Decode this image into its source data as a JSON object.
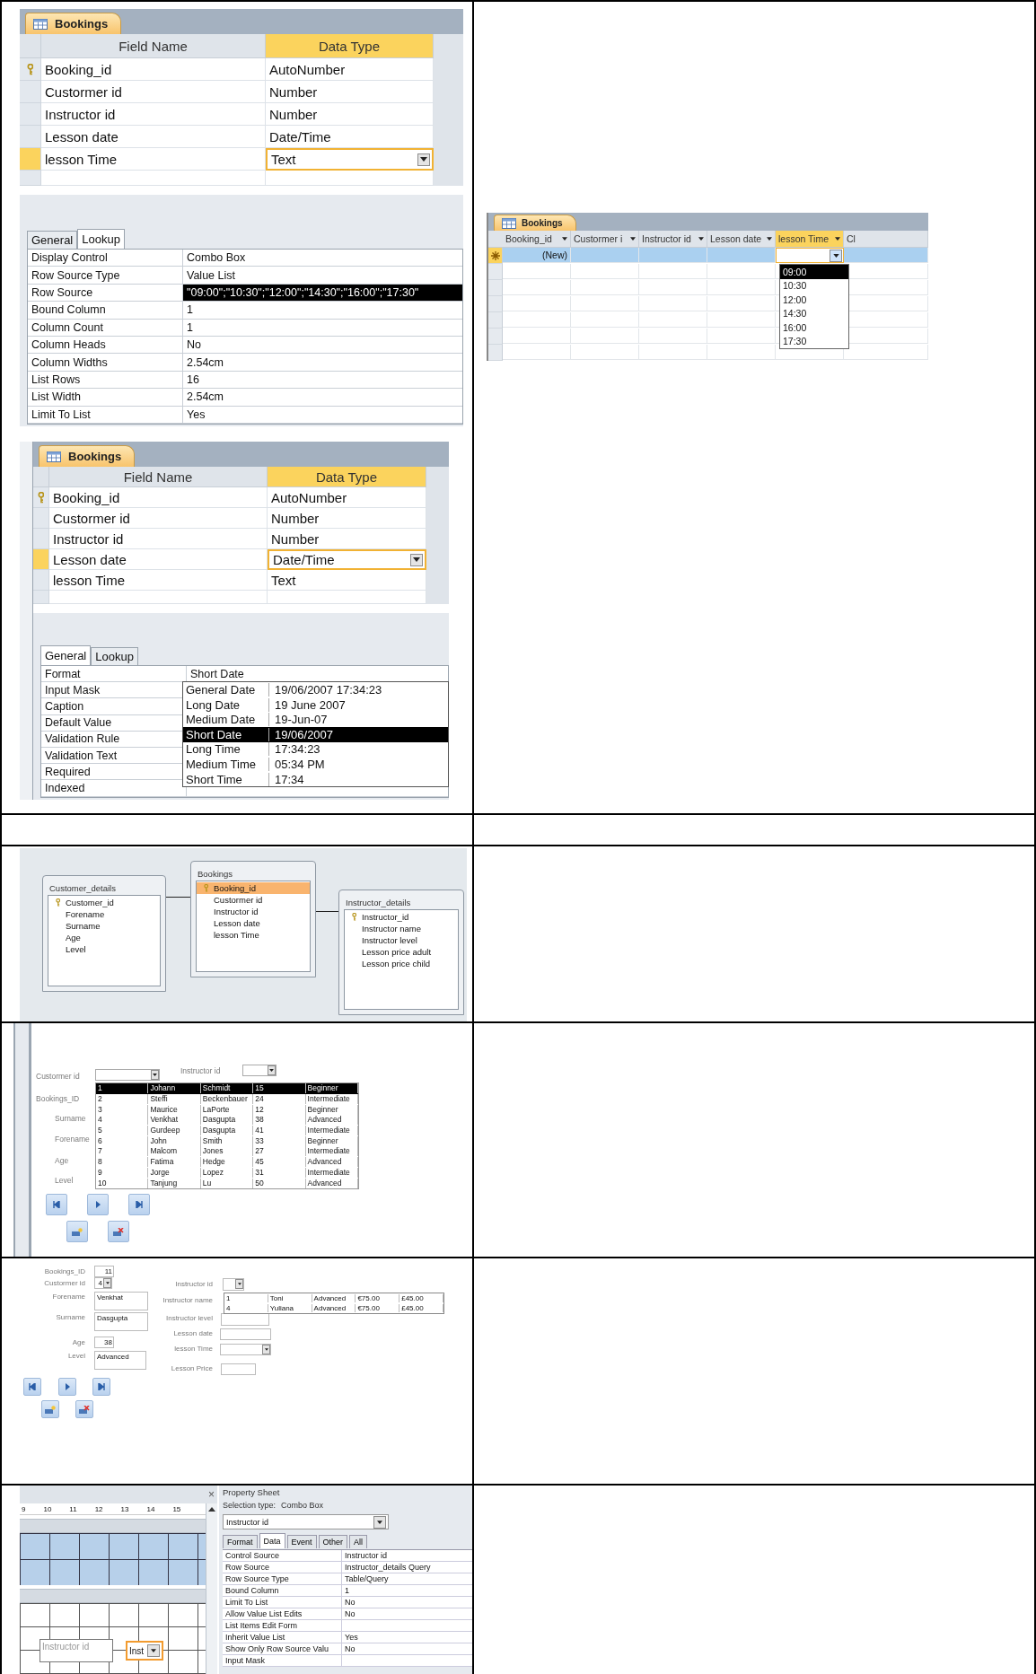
{
  "design_views": [
    {
      "tab": "Bookings",
      "columns": [
        {
          "label": "Field Name",
          "selected": false
        },
        {
          "label": "Data Type",
          "selected": true
        }
      ],
      "fields": [
        {
          "name": "Booking_id",
          "type": "AutoNumber",
          "primary_key": true,
          "selected": false
        },
        {
          "name": "Custormer id",
          "type": "Number",
          "primary_key": false,
          "selected": false
        },
        {
          "name": "Instructor id",
          "type": "Number",
          "primary_key": false,
          "selected": false
        },
        {
          "name": "Lesson date",
          "type": "Date/Time",
          "primary_key": false,
          "selected": false
        },
        {
          "name": "lesson Time",
          "type": "Text",
          "primary_key": false,
          "selected": true
        }
      ],
      "property_tabs": [
        {
          "label": "General",
          "selected": false
        },
        {
          "label": "Lookup",
          "selected": true
        }
      ],
      "properties": [
        {
          "name": "Display Control",
          "value": "Combo Box",
          "selected": false
        },
        {
          "name": "Row Source Type",
          "value": "Value List",
          "selected": false
        },
        {
          "name": "Row Source",
          "value": "\"09:00\";\"10:30\";\"12:00\";\"14:30\";\"16:00\";\"17:30\"",
          "selected": true
        },
        {
          "name": "Bound Column",
          "value": "1",
          "selected": false
        },
        {
          "name": "Column Count",
          "value": "1",
          "selected": false
        },
        {
          "name": "Column Heads",
          "value": "No",
          "selected": false
        },
        {
          "name": "Column Widths",
          "value": "2.54cm",
          "selected": false
        },
        {
          "name": "List Rows",
          "value": "16",
          "selected": false
        },
        {
          "name": "List Width",
          "value": "2.54cm",
          "selected": false
        },
        {
          "name": "Limit To List",
          "value": "Yes",
          "selected": false
        }
      ]
    },
    {
      "tab": "Bookings",
      "columns": [
        {
          "label": "Field Name",
          "selected": false
        },
        {
          "label": "Data Type",
          "selected": true
        }
      ],
      "fields": [
        {
          "name": "Booking_id",
          "type": "AutoNumber",
          "primary_key": true,
          "selected": false
        },
        {
          "name": "Custormer id",
          "type": "Number",
          "primary_key": false,
          "selected": false
        },
        {
          "name": "Instructor id",
          "type": "Number",
          "primary_key": false,
          "selected": false
        },
        {
          "name": "Lesson date",
          "type": "Date/Time",
          "primary_key": false,
          "selected": true
        },
        {
          "name": "lesson Time",
          "type": "Text",
          "primary_key": false,
          "selected": false
        }
      ],
      "property_tabs": [
        {
          "label": "General",
          "selected": true
        },
        {
          "label": "Lookup",
          "selected": false
        }
      ],
      "properties": [
        {
          "name": "Format",
          "value": "Short Date"
        },
        {
          "name": "Input Mask"
        },
        {
          "name": "Caption"
        },
        {
          "name": "Default Value"
        },
        {
          "name": "Validation Rule"
        },
        {
          "name": "Validation Text"
        },
        {
          "name": "Required"
        },
        {
          "name": "Indexed"
        }
      ],
      "format_list": [
        {
          "name": "General Date",
          "example": "19/06/2007 17:34:23",
          "selected": false
        },
        {
          "name": "Long Date",
          "example": "19 June 2007",
          "selected": false
        },
        {
          "name": "Medium Date",
          "example": "19-Jun-07",
          "selected": false
        },
        {
          "name": "Short Date",
          "example": "19/06/2007",
          "selected": true
        },
        {
          "name": "Long Time",
          "example": "17:34:23",
          "selected": false
        },
        {
          "name": "Medium Time",
          "example": "05:34 PM",
          "selected": false
        },
        {
          "name": "Short Time",
          "example": "17:34",
          "selected": false
        }
      ]
    }
  ],
  "datasheet": {
    "tab": "Bookings",
    "columns": [
      {
        "label": "Booking_id",
        "selected": false
      },
      {
        "label": "Custormer i",
        "selected": false
      },
      {
        "label": "Instructor id",
        "selected": false
      },
      {
        "label": "Lesson date",
        "selected": false
      },
      {
        "label": "lesson Time",
        "selected": true
      },
      {
        "label": "Cl",
        "selected": false
      }
    ],
    "new_row_label": "(New)",
    "time_options": [
      {
        "label": "09:00",
        "selected": true
      },
      {
        "label": "10:30",
        "selected": false
      },
      {
        "label": "12:00",
        "selected": false
      },
      {
        "label": "14:30",
        "selected": false
      },
      {
        "label": "16:00",
        "selected": false
      },
      {
        "label": "17:30",
        "selected": false
      }
    ]
  },
  "relationships": {
    "tables": [
      {
        "name": "Customer_details",
        "fields": [
          {
            "name": "Customer_id",
            "primary_key": true,
            "selected": false
          },
          {
            "name": "Forename",
            "primary_key": false,
            "selected": false
          },
          {
            "name": "Surname",
            "primary_key": false,
            "selected": false
          },
          {
            "name": "Age",
            "primary_key": false,
            "selected": false
          },
          {
            "name": "Level",
            "primary_key": false,
            "selected": false
          }
        ]
      },
      {
        "name": "Bookings",
        "fields": [
          {
            "name": "Booking_id",
            "primary_key": true,
            "selected": true
          },
          {
            "name": "Custormer id",
            "primary_key": false,
            "selected": false
          },
          {
            "name": "Instructor id",
            "primary_key": false,
            "selected": false
          },
          {
            "name": "Lesson date",
            "primary_key": false,
            "selected": false
          },
          {
            "name": "lesson Time",
            "primary_key": false,
            "selected": false
          }
        ]
      },
      {
        "name": "Instructor_details",
        "fields": [
          {
            "name": "Instructor_id",
            "primary_key": true,
            "selected": false
          },
          {
            "name": "Instructor name",
            "primary_key": false,
            "selected": false
          },
          {
            "name": "Instructor level",
            "primary_key": false,
            "selected": false
          },
          {
            "name": "Lesson price adult",
            "primary_key": false,
            "selected": false
          },
          {
            "name": "Lesson price child",
            "primary_key": false,
            "selected": false
          }
        ]
      }
    ]
  },
  "customer_form": {
    "fields": [
      {
        "label": "Custormer id",
        "kind": "combo"
      },
      {
        "label": "Instructor id",
        "kind": "combo"
      },
      {
        "label": "Bookings_ID",
        "kind": "label"
      },
      {
        "label": "Surname",
        "kind": "label"
      },
      {
        "label": "Forename",
        "kind": "label"
      },
      {
        "label": "Age",
        "kind": "label"
      },
      {
        "label": "Level",
        "kind": "label"
      }
    ],
    "list_rows": [
      {
        "cells": [
          "1",
          "Johann",
          "Schmidt",
          "15",
          "Beginner"
        ],
        "selected": true
      },
      {
        "cells": [
          "2",
          "Steffi",
          "Beckenbauer",
          "24",
          "Intermediate"
        ],
        "selected": false
      },
      {
        "cells": [
          "3",
          "Maurice",
          "LaPorte",
          "12",
          "Beginner"
        ],
        "selected": false
      },
      {
        "cells": [
          "4",
          "Venkhat",
          "Dasgupta",
          "38",
          "Advanced"
        ],
        "selected": false
      },
      {
        "cells": [
          "5",
          "Gurdeep",
          "Dasgupta",
          "41",
          "Intermediate"
        ],
        "selected": false
      },
      {
        "cells": [
          "6",
          "John",
          "Smith",
          "33",
          "Beginner"
        ],
        "selected": false
      },
      {
        "cells": [
          "7",
          "Malcom",
          "Jones",
          "27",
          "Intermediate"
        ],
        "selected": false
      },
      {
        "cells": [
          "8",
          "Fatima",
          "Hedge",
          "45",
          "Advanced"
        ],
        "selected": false
      },
      {
        "cells": [
          "9",
          "Jorge",
          "Lopez",
          "31",
          "Intermediate"
        ],
        "selected": false
      },
      {
        "cells": [
          "10",
          "Tanjung",
          "Lu",
          "50",
          "Advanced"
        ],
        "selected": false
      }
    ],
    "nav_buttons": [
      {
        "kind": "first"
      },
      {
        "kind": "next"
      },
      {
        "kind": "last"
      },
      {
        "kind": "new"
      },
      {
        "kind": "delete"
      }
    ]
  },
  "booking_form": {
    "fields": [
      {
        "label": "Bookings_ID",
        "kind": "number",
        "value": "11"
      },
      {
        "label": "Custormer id",
        "kind": "combo",
        "value": "4"
      },
      {
        "label": "Forename",
        "kind": "text",
        "value": "Venkhat"
      },
      {
        "label": "Surname",
        "kind": "text",
        "value": "Dasgupta"
      },
      {
        "label": "Age",
        "kind": "number",
        "value": "38"
      },
      {
        "label": "Level",
        "kind": "text",
        "value": "Advanced"
      },
      {
        "label": "Instructor id",
        "kind": "combo"
      },
      {
        "label": "Instructor name",
        "kind": "label"
      },
      {
        "label": "Instructor level",
        "kind": "text"
      },
      {
        "label": "Lesson date",
        "kind": "text"
      },
      {
        "label": "lesson Time",
        "kind": "combo"
      },
      {
        "label": "Lesson Price",
        "kind": "text"
      }
    ],
    "list_rows": [
      [
        "1",
        "Toni",
        "Advanced",
        "€75.00",
        "£45.00"
      ],
      [
        "4",
        "Yuliana",
        "Advanced",
        "€75.00",
        "£45.00"
      ]
    ],
    "nav_buttons": [
      {
        "kind": "first"
      },
      {
        "kind": "next"
      },
      {
        "kind": "last"
      },
      {
        "kind": "new"
      },
      {
        "kind": "delete"
      }
    ]
  },
  "form_design": {
    "close": "×",
    "ruler": [
      "9",
      "10",
      "11",
      "12",
      "13",
      "14",
      "15"
    ],
    "controls": [
      {
        "text": "Instructor id",
        "kind": "label",
        "selected": false
      },
      {
        "text": "Inst",
        "kind": "combo",
        "selected": true
      }
    ]
  },
  "property_sheet": {
    "title": "Property Sheet",
    "selection_label": "Selection type:",
    "selection_type": "Combo Box",
    "object": "Instructor id",
    "tabs": [
      {
        "label": "Format",
        "selected": false
      },
      {
        "label": "Data",
        "selected": true
      },
      {
        "label": "Event",
        "selected": false
      },
      {
        "label": "Other",
        "selected": false
      },
      {
        "label": "All",
        "selected": false
      }
    ],
    "properties": [
      {
        "name": "Control Source",
        "value": "Instructor id"
      },
      {
        "name": "Row Source",
        "value": "Instructor_details Query"
      },
      {
        "name": "Row Source Type",
        "value": "Table/Query"
      },
      {
        "name": "Bound Column",
        "value": "1"
      },
      {
        "name": "Limit To List",
        "value": "No"
      },
      {
        "name": "Allow Value List Edits",
        "value": "No"
      },
      {
        "name": "List Items Edit Form"
      },
      {
        "name": "Inherit Value List",
        "value": "Yes"
      },
      {
        "name": "Show Only Row Source Valu",
        "value": "No"
      },
      {
        "name": "Input Mask"
      }
    ]
  }
}
